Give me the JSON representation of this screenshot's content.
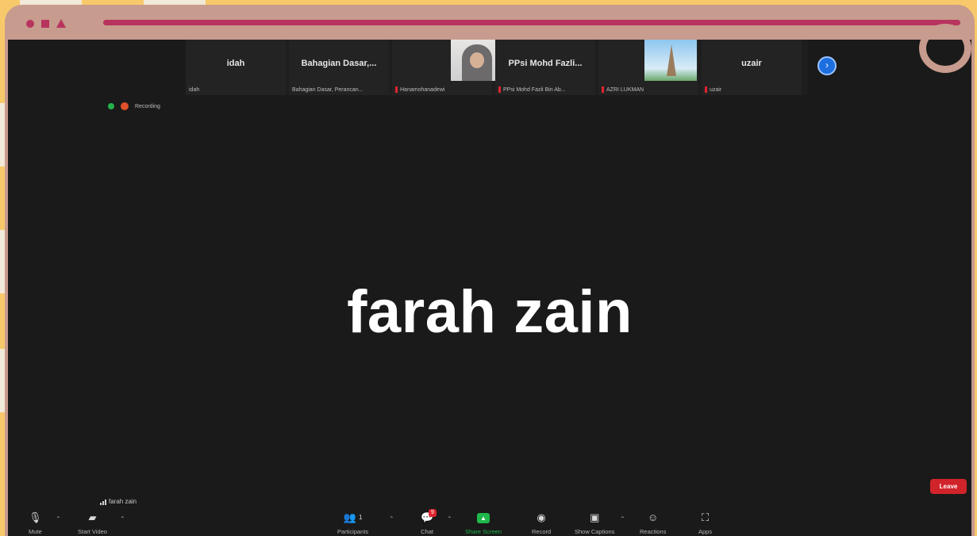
{
  "gallery": {
    "tiles": [
      {
        "name": "idah",
        "label": "idah",
        "muted": false
      },
      {
        "name": "Bahagian  Dasar,...",
        "label": "Bahagian Dasar, Perancan...",
        "muted": false
      },
      {
        "name": "",
        "label": "Hanamohanadewi",
        "muted": true,
        "photo": "person-in-hijab"
      },
      {
        "name": "PPsi  Mohd  Fazli...",
        "label": "PPsi Mohd Fazli Bin Ab...",
        "muted": true
      },
      {
        "name": "",
        "label": "AZRI LUKMAN",
        "muted": true,
        "photo": "eiffel-tower"
      },
      {
        "name": "uzair",
        "label": "uzair",
        "muted": true
      }
    ],
    "next_icon": "chevron-right-icon"
  },
  "status": {
    "recording_text": "Recording"
  },
  "speaker": {
    "name": "farah zain"
  },
  "self_view": {
    "label": "farah zain"
  },
  "toolbar": {
    "mute": "Mute",
    "start_video": "Start Video",
    "participants": "Participants",
    "participants_count": "1",
    "chat": "Chat",
    "chat_badge": "9",
    "share_screen": "Share Screen",
    "record": "Record",
    "show_captions": "Show Captions",
    "reactions": "Reactions",
    "apps": "Apps",
    "leave": "Leave"
  },
  "colors": {
    "accent": "#b8345f",
    "frame": "#c79b8d",
    "background": "#f7c96b",
    "leave": "#d1232a",
    "share": "#1fb84a"
  }
}
